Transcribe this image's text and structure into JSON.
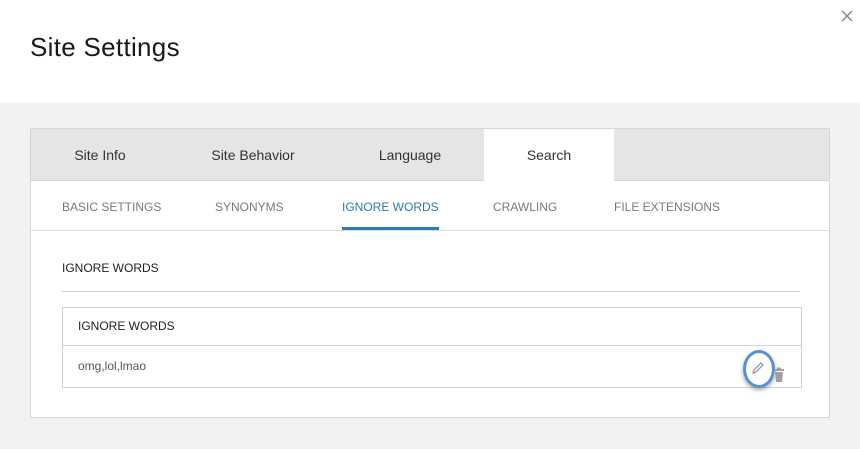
{
  "modal": {
    "title": "Site Settings",
    "close_icon": "close-icon"
  },
  "tabs": [
    {
      "label": "Site Info",
      "active": false
    },
    {
      "label": "Site Behavior",
      "active": false
    },
    {
      "label": "Language",
      "active": false
    },
    {
      "label": "Search",
      "active": true
    }
  ],
  "subtabs": [
    {
      "label": "BASIC SETTINGS",
      "active": false
    },
    {
      "label": "SYNONYMS",
      "active": false
    },
    {
      "label": "IGNORE WORDS",
      "active": true
    },
    {
      "label": "CRAWLING",
      "active": false
    },
    {
      "label": "FILE EXTENSIONS",
      "active": false
    }
  ],
  "section": {
    "title": "IGNORE WORDS"
  },
  "table": {
    "header": "IGNORE WORDS",
    "rows": [
      {
        "value": "omg,lol,lmao"
      }
    ],
    "row_actions": {
      "edit_icon": "pencil-icon",
      "delete_icon": "trash-icon"
    }
  },
  "colors": {
    "accent": "#2a7bb8",
    "highlight_ring": "#5a8fd6",
    "tab_bar": "#e5e5e5",
    "page_bg": "#f2f2f2"
  }
}
